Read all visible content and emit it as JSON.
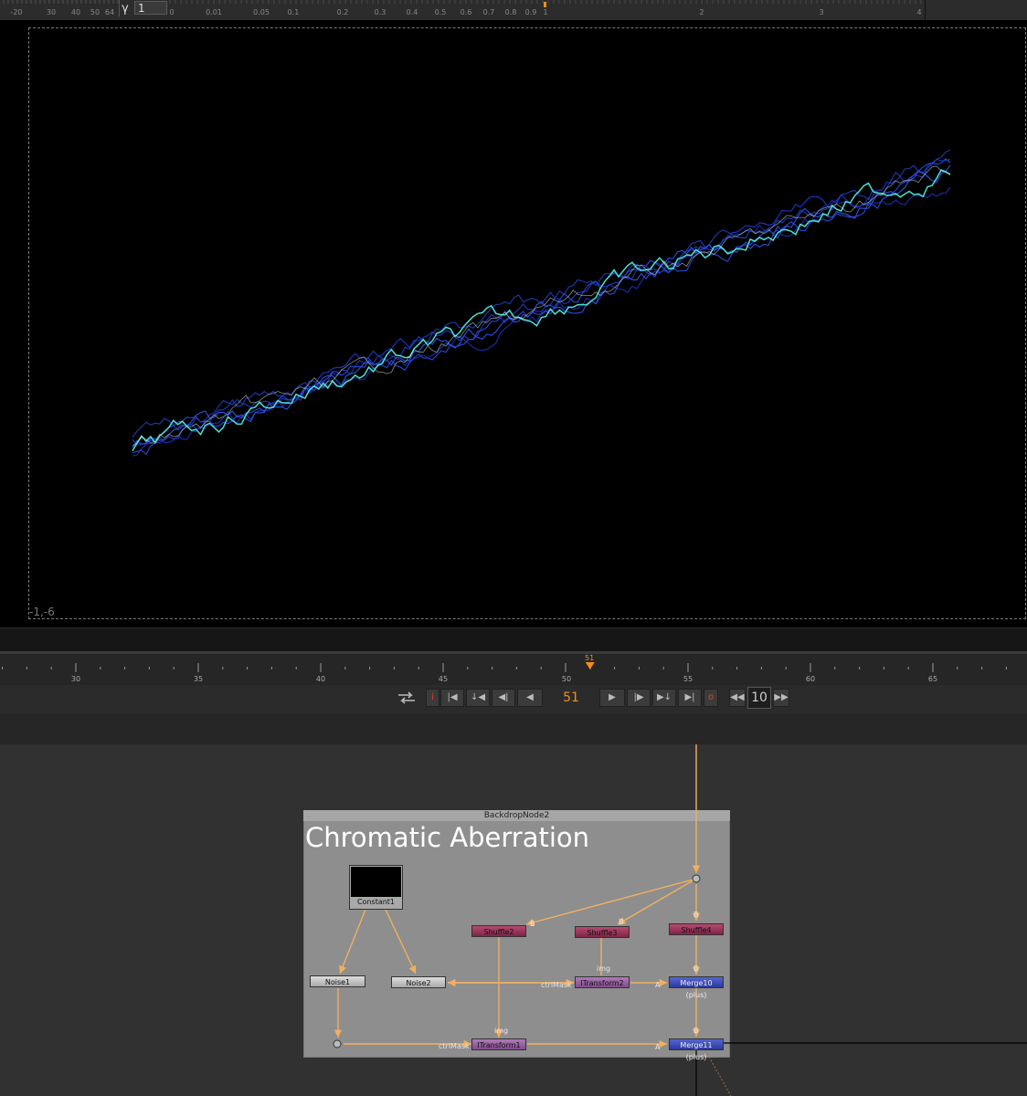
{
  "viewer_toolbar": {
    "gamma_label": "γ",
    "gamma_value": "1",
    "exposure_ticks": [
      "-20",
      "30",
      "40",
      "50",
      "64"
    ],
    "gain_ticks": [
      "0",
      "0.01",
      "0.05",
      "0.1",
      "0.2",
      "0.3",
      "0.4",
      "0.5",
      "0.6",
      "0.7",
      "0.8",
      "0.9",
      "1",
      "2",
      "3",
      "4"
    ]
  },
  "viewer": {
    "coordinate_readout": "-1,-6"
  },
  "timeline": {
    "ticks": [
      "30",
      "35",
      "40",
      "45",
      "50",
      "55",
      "60",
      "65"
    ],
    "current_frame_marker": "51"
  },
  "transport": {
    "loop_icon": "loop-cycle-icon",
    "in_point_label": "i",
    "out_point_label": "o",
    "current_frame": "51",
    "increment_value": "10"
  },
  "node_graph": {
    "backdrop": {
      "header": "BackdropNode2",
      "title": "Chromatic Aberration"
    },
    "nodes": {
      "constant": "Constant1",
      "noise1": "Noise1",
      "noise2": "Noise2",
      "shuffle2": "Shuffle2",
      "shuffle3": "Shuffle3",
      "shuffle4": "Shuffle4",
      "itransform2": "ITransform2",
      "itransform1": "ITransform1",
      "merge10": "Merge10 (plus)",
      "merge11": "Merge11 (plus)"
    },
    "input_labels": {
      "b": "B",
      "a": "A",
      "img": "img",
      "ctrl_mask": "ctrlMask"
    }
  },
  "colors": {
    "accent_orange": "#f08f1c",
    "pipe_color": "#f0b060",
    "shuffle_node": "#9b3558",
    "itransform_node": "#9a62a3",
    "merge_node": "#3e4cc0",
    "plot_cyan": "#4de0d0",
    "plot_blue": "#2a3fd0"
  }
}
